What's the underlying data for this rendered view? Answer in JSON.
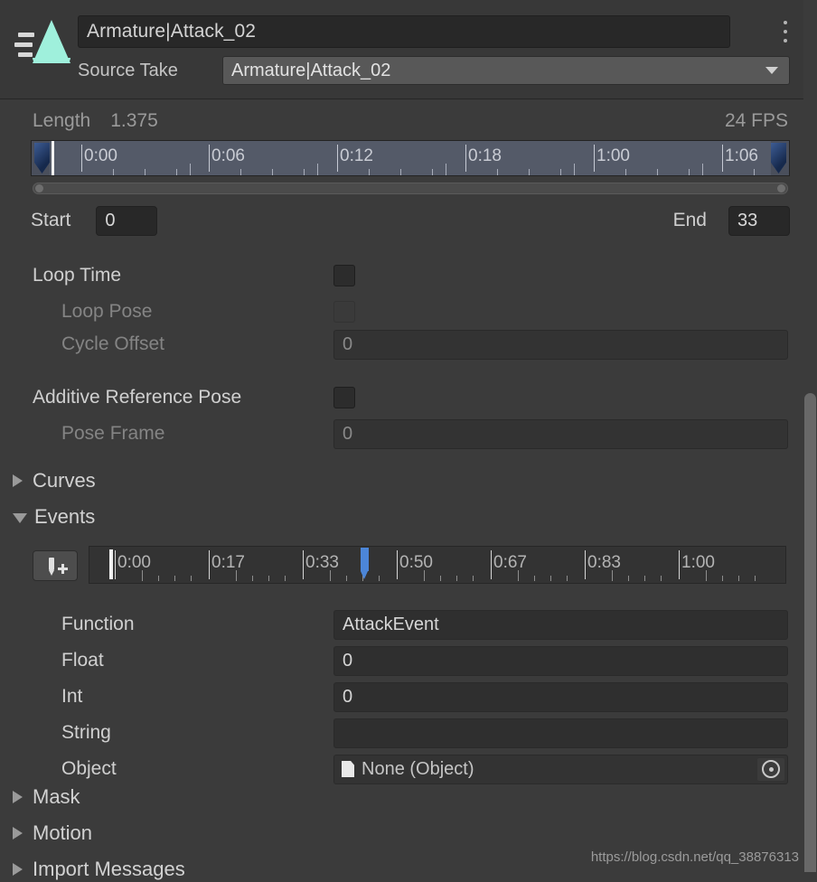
{
  "header": {
    "asset_name": "Armature|Attack_02",
    "source_take_label": "Source Take",
    "source_take_value": "Armature|Attack_02",
    "menu_icon": "kebab-menu-icon"
  },
  "clip": {
    "length_label": "Length",
    "length_value": "1.375",
    "fps": "24 FPS",
    "start_label": "Start",
    "start_value": "0",
    "end_label": "End",
    "end_value": "33",
    "ruler_labels": [
      "0:00",
      "0:06",
      "0:12",
      "0:18",
      "1:00",
      "1:06"
    ]
  },
  "properties": [
    {
      "label": "Loop Time",
      "type": "checkbox",
      "value": "",
      "dimmed": false
    },
    {
      "label": "Loop Pose",
      "type": "checkbox",
      "value": "",
      "dimmed": true
    },
    {
      "label": "Cycle Offset",
      "type": "text",
      "value": "0",
      "dimmed": true
    },
    {
      "label": "Additive Reference Pose",
      "type": "checkbox",
      "value": "",
      "dimmed": false
    },
    {
      "label": "Pose Frame",
      "type": "text",
      "value": "0",
      "dimmed": true
    }
  ],
  "foldouts": {
    "curves": "Curves",
    "events": "Events",
    "mask": "Mask",
    "motion": "Motion",
    "import_messages": "Import Messages"
  },
  "events": {
    "add_button_icon": "add-event-marker-icon",
    "ruler_labels": [
      "0:00",
      "0:17",
      "0:33",
      "0:50",
      "0:67",
      "0:83",
      "1:00"
    ],
    "marker_position_label": "0:33",
    "fields": [
      {
        "label": "Function",
        "value": "AttackEvent",
        "type": "text"
      },
      {
        "label": "Float",
        "value": "0",
        "type": "text"
      },
      {
        "label": "Int",
        "value": "0",
        "type": "text"
      },
      {
        "label": "String",
        "value": "",
        "type": "text"
      },
      {
        "label": "Object",
        "value": "None (Object)",
        "type": "object"
      }
    ]
  },
  "watermark": "https://blog.csdn.net/qq_38876313",
  "colors": {
    "panel_bg": "#3b3b3b",
    "header_bg": "#383838",
    "field_bg": "#333333",
    "accent_icon": "#9ff0dc",
    "event_marker": "#4c86d8",
    "ruler_bg": "#545a68",
    "handle": "#1d3a6b"
  }
}
